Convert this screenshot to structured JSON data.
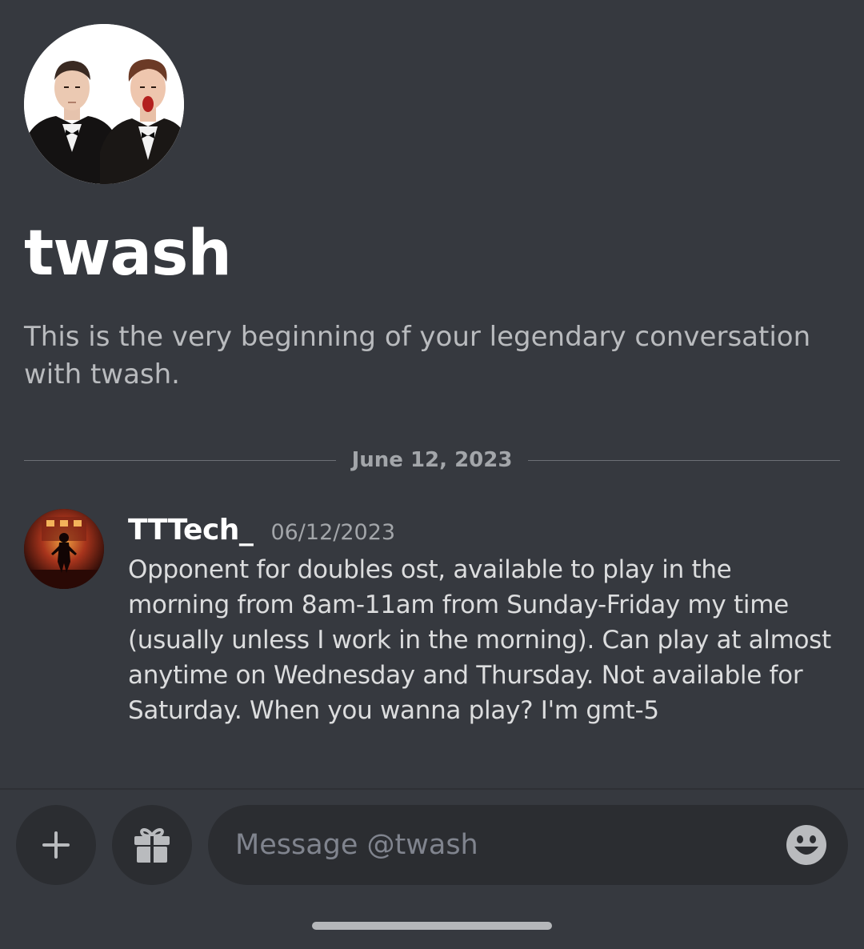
{
  "profile": {
    "avatar_icon": "profile-photo-two-men-in-tuxedos",
    "name": "twash",
    "intro": "This is the very beginning of your legendary conversation with twash."
  },
  "divider": {
    "date": "June 12, 2023"
  },
  "messages": [
    {
      "avatar_icon": "figure-in-red-room-avatar",
      "author": "TTTech_",
      "timestamp": "06/12/2023",
      "content": "Opponent for doubles ost, available to play in the morning from 8am-11am from Sunday-Friday my time (usually unless I work in the morning). Can play at almost anytime on Wednesday and Thursday. Not available for Saturday. When you wanna play? I'm gmt-5"
    }
  ],
  "composer": {
    "placeholder": "Message @twash",
    "value": "",
    "attach_icon": "plus-icon",
    "gift_icon": "gift-icon",
    "emoji_icon": "smiley-icon"
  },
  "colors": {
    "background": "#36393f",
    "input_background": "#2b2d31",
    "text_primary": "#ffffff",
    "text_muted": "#b9bbbe"
  }
}
